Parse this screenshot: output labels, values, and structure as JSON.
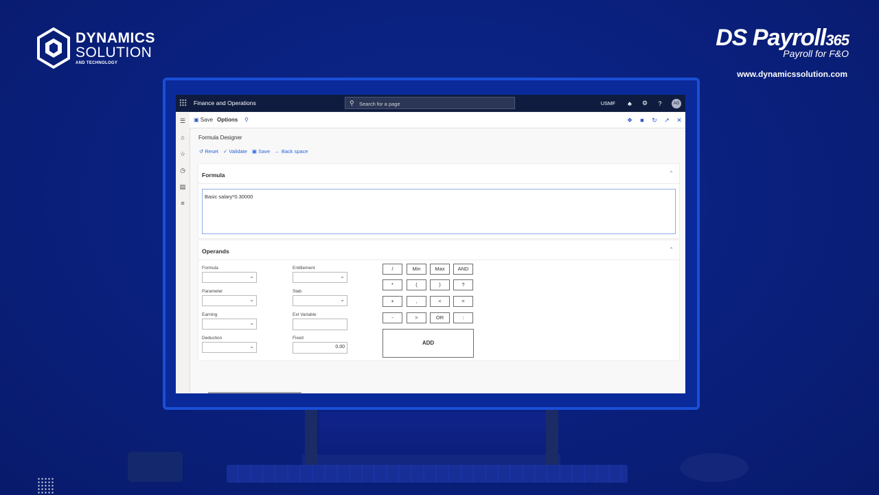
{
  "brand": {
    "logo_line1": "DYNAMICS",
    "logo_line2": "SOLUTION",
    "logo_line3": "AND TECHNOLOGY",
    "product_main": "DS Payroll",
    "product_num": "365",
    "product_sub": "Payroll for F&O",
    "website": "www.dynamicssolution.com"
  },
  "topbar": {
    "app_title": "Finance and Operations",
    "search_placeholder": "Search for a page",
    "company": "USMF",
    "avatar": "AG"
  },
  "actionbar": {
    "save": "Save",
    "options": "Options"
  },
  "page": {
    "title": "Formula Designer",
    "actions": {
      "reset": "Reset",
      "validate": "Validate",
      "save": "Save",
      "back_space": "Back space"
    }
  },
  "formula": {
    "section_title": "Formula",
    "value": "Basic salary*0.30000"
  },
  "operands": {
    "section_title": "Operands",
    "fields": {
      "formula": "Formula",
      "parameter": "Parameter",
      "earning": "Earning",
      "deduction": "Deduction",
      "entitlement": "Entitlement",
      "slab": "Slab",
      "ext_variable": "Ext Variable",
      "fixed": "Fixed",
      "fixed_value": "0.00"
    },
    "keys": [
      "/",
      "Min",
      "Max",
      "AND",
      "*",
      "(",
      ")",
      "?",
      "+",
      ",",
      "<",
      "=",
      "-",
      ">",
      "OR",
      ":"
    ],
    "add": "ADD"
  },
  "icons": {
    "search": "search-icon",
    "bell": "bell-icon",
    "gear": "gear-icon",
    "help": "help-icon",
    "hamburger": "hamburger-icon",
    "home": "home-icon",
    "star": "star-icon",
    "clock": "clock-icon",
    "workspace": "workspace-icon",
    "list": "list-icon"
  },
  "colors": {
    "background": "#0a2180",
    "topbar": "#0f1c3f",
    "link": "#2b63d6",
    "monitor_border": "#1a4fd6"
  }
}
